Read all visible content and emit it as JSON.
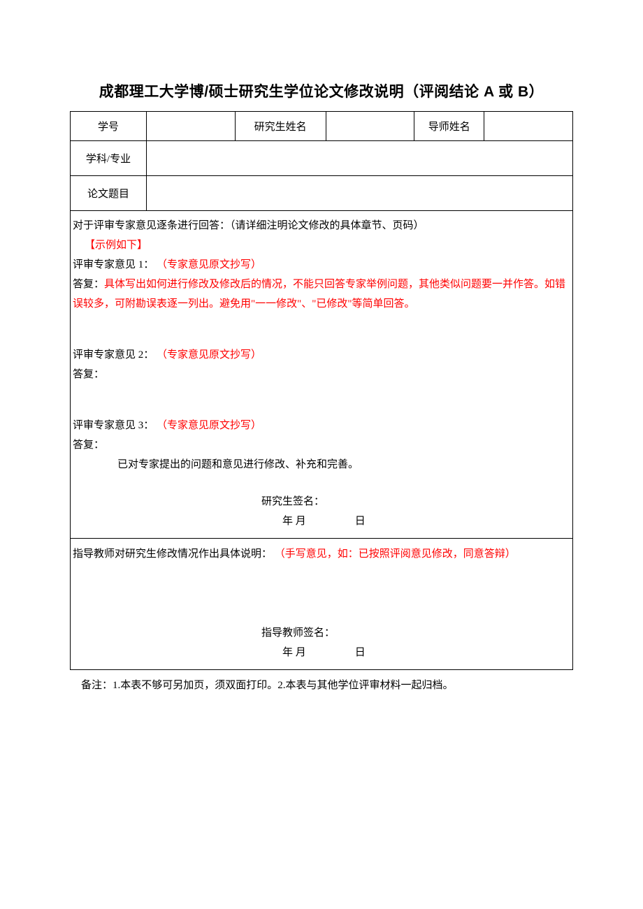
{
  "title": "成都理工大学博/硕士研究生学位论文修改说明（评阅结论 A 或 B）",
  "header": {
    "student_id_label": "学号",
    "student_id_value": "",
    "student_name_label": "研究生姓名",
    "student_name_value": "",
    "advisor_name_label": "导师姓名",
    "advisor_name_value": "",
    "major_label": "学科/专业",
    "major_value": "",
    "thesis_title_label": "论文题目",
    "thesis_title_value": ""
  },
  "body": {
    "intro": "对于评审专家意见逐条进行回答：（请详细注明论文修改的具体章节、页码）",
    "example_tag": "【示例如下】",
    "item1_label": "评审专家意见 1：",
    "item1_hint": "（专家意见原文抄写）",
    "reply1_label": "答复：",
    "reply1_text": "具体写出如何进行修改及修改后的情况，不能只回答专家举例问题，其他类似问题要一并作答。如错误较多，可附勘误表逐一列出。避免用\"一一修改\"、\"已修改\"等简单回答。",
    "item2_label": "评审专家意见 2：",
    "item2_hint": "（专家意见原文抄写）",
    "reply2_label": "答复：",
    "item3_label": "评审专家意见 3：",
    "item3_hint": "（专家意见原文抄写）",
    "reply3_label": "答复：",
    "confirm_text": "已对专家提出的问题和意见进行修改、补充和完善。",
    "student_sign_label": "研究生签名：",
    "date_ym": "年  月",
    "date_d": "日"
  },
  "advisor": {
    "intro_label": "指导教师对研究生修改情况作出具体说明：",
    "intro_hint": "（手写意见，如：已按照评阅意见修改，同意答辩）",
    "advisor_sign_label": "指导教师签名：",
    "date_ym": "年  月",
    "date_d": "日"
  },
  "notes": "备注：1.本表不够可另加页，须双面打印。2.本表与其他学位评审材料一起归档。"
}
